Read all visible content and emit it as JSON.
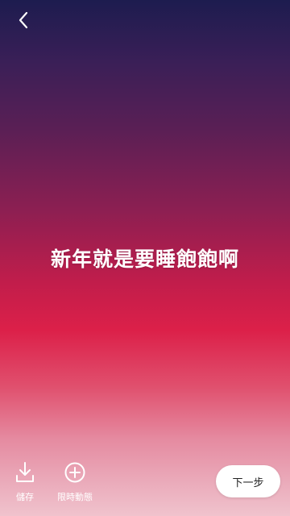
{
  "header": {
    "back_icon": "chevron-left-icon"
  },
  "story": {
    "text": "新年就是要睡飽飽啊"
  },
  "toolbar": {
    "save_label": "儲存",
    "save_icon": "download-icon",
    "story_label": "限時動態",
    "story_icon": "plus-circle-icon"
  },
  "next_button": {
    "label": "下一步"
  },
  "colors": {
    "gradient_top": "#1d1c4f",
    "gradient_middle": "#dc2049",
    "gradient_bottom": "#f0c3cd",
    "text": "#ffffff",
    "button_bg": "#ffffff"
  }
}
